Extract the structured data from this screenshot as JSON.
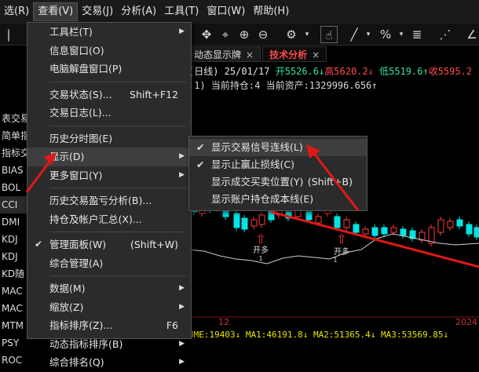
{
  "menubar": [
    "选(R)",
    "查看(V)",
    "交易(J)",
    "分析(A)",
    "工具(T)",
    "窗口(W)",
    "帮助(H)"
  ],
  "tabs": [
    {
      "label": "动态显示牌",
      "close": "×"
    },
    {
      "label": "技术分析",
      "close": "×"
    }
  ],
  "info": {
    "line1_prefix": "(日线) 25/01/17",
    "open": "开5526.6↓",
    "high": "高5620.2↓",
    "low": "低5519.6↑",
    "close": "收5595.2",
    "line2": ",1) 当前持仓:4 当前资产:1329996.656↑"
  },
  "leftlist": [
    "表交易系",
    "简单指",
    "指标交",
    "BIAS",
    "BOL",
    "CCI",
    "DMI",
    "KDJ",
    "KDJ",
    "KD随",
    "MAC",
    "MAC",
    "MTM",
    "PSY",
    "ROC"
  ],
  "menu": {
    "items": [
      {
        "label": "工具栏(T)",
        "arrow": "▶"
      },
      {
        "label": "信息窗口(O)"
      },
      {
        "label": "电脑解盘窗口(P)"
      },
      {
        "sep": true
      },
      {
        "label": "交易状态(S)...",
        "shortcut": "Shift+F12"
      },
      {
        "label": "交易日志(L)..."
      },
      {
        "sep": true
      },
      {
        "label": "历史分时图(E)"
      },
      {
        "label": "显示(D)",
        "arrow": "▶",
        "highlight": true
      },
      {
        "label": "更多窗口(Y)",
        "arrow": "▶"
      },
      {
        "sep": true
      },
      {
        "label": "历史交易盈亏分析(B)..."
      },
      {
        "label": "持仓及帐户汇总(X)..."
      },
      {
        "sep": true
      },
      {
        "label": "管理面板(W)",
        "shortcut": "(Shift+W)",
        "check": "✔"
      },
      {
        "label": "综合管理(A)"
      },
      {
        "sep": true
      },
      {
        "label": "数据(M)",
        "arrow": "▶"
      },
      {
        "label": "缩放(Z)",
        "arrow": "▶"
      },
      {
        "label": "指标排序(Z)...",
        "shortcut": "F6"
      },
      {
        "label": "动态指标排序(B)",
        "arrow": "▶"
      },
      {
        "label": "综合排名(Q)",
        "arrow": "▶"
      }
    ]
  },
  "submenu": {
    "items": [
      {
        "label": "显示交易信号连线(L)",
        "check": "✔",
        "highlight": true
      },
      {
        "label": "显示止赢止损线(C)",
        "check": "✔"
      },
      {
        "label": "显示成交买卖位置(Y)",
        "shortcut": "(Shift+B)"
      },
      {
        "label": "显示账户持仓成本线(E)"
      }
    ]
  },
  "chart": {
    "signals": [
      {
        "text": "开多",
        "count": "1"
      },
      {
        "text": "开多",
        "count": "1"
      }
    ],
    "date_labels": [
      "12",
      "2024"
    ],
    "volume_line": "UME:19403↓ MA1:46191.8↓ MA2:51365.4↓ MA3:53569.85↓",
    "colors": {
      "up": "#ff3b3b",
      "down": "#00e5e5",
      "ma": "#cccccc",
      "arrow": "#ee1c1c"
    }
  }
}
